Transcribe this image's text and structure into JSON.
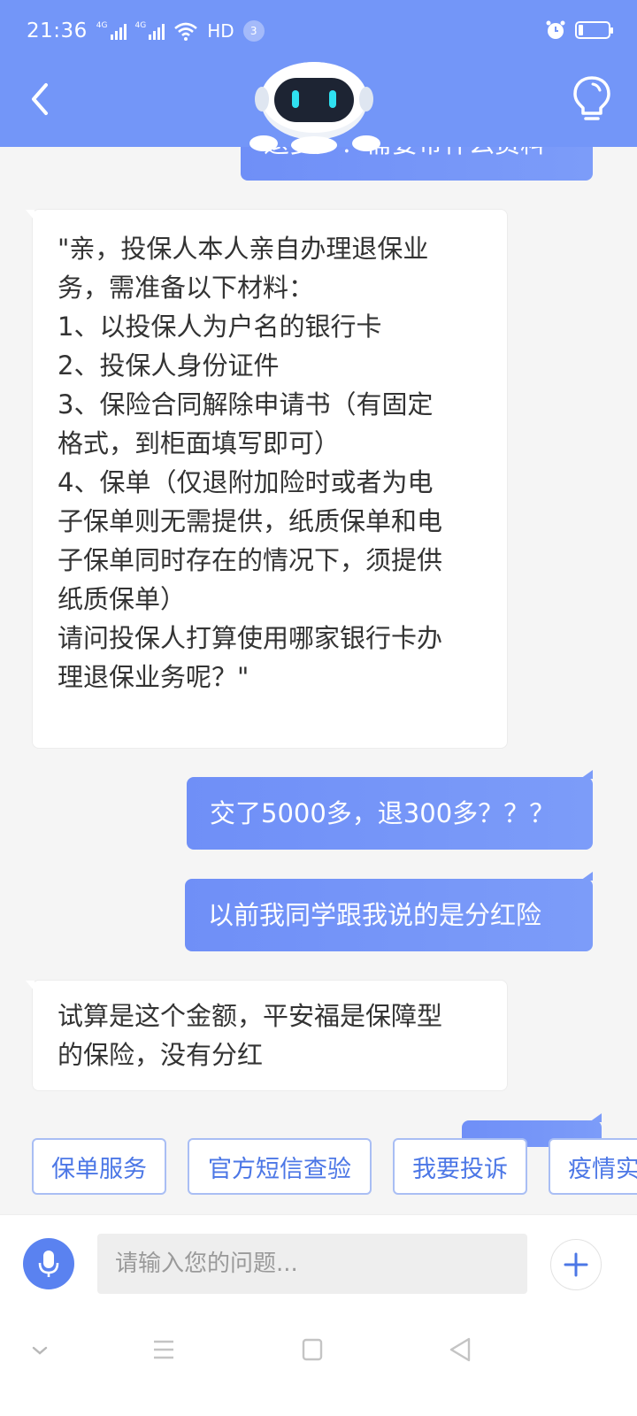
{
  "status_bar": {
    "time": "21:36",
    "signal1_tag": "4G",
    "signal2_tag": "4G",
    "hd_label": "HD",
    "notification_count": "3"
  },
  "header": {
    "accent_color": "#7396f8",
    "back_icon": "chevron-left-icon",
    "bulb_icon": "lightbulb-icon",
    "mascot": "robot-avatar"
  },
  "chat": {
    "partial_user_message": "退多少？需要带什么资料",
    "messages": [
      {
        "sender": "bot",
        "text": "\"亲，投保人本人亲自办理退保业\n务，需准备以下材料：\n1、以投保人为户名的银行卡\n2、投保人身份证件\n3、保险合同解除申请书（有固定\n格式，到柜面填写即可）\n4、保单（仅退附加险时或者为电\n子保单则无需提供，纸质保单和电\n子保单同时存在的情况下，须提供\n纸质保单）\n请问投保人打算使用哪家银行卡办\n理退保业务呢？\""
      },
      {
        "sender": "user",
        "text": "交了5000多，退300多？？？"
      },
      {
        "sender": "user",
        "text": "以前我同学跟我说的是分红险"
      },
      {
        "sender": "bot",
        "text": "试算是这个金额，平安福是保障型\n的保险，没有分红"
      }
    ]
  },
  "quick_replies": [
    "保单服务",
    "官方短信查验",
    "我要投诉",
    "疫情实"
  ],
  "input": {
    "placeholder": "请输入您的问题...",
    "mic_icon": "microphone-icon",
    "plus_icon": "plus-icon"
  },
  "system_nav": [
    "chevron-down-icon",
    "menu-icon",
    "home-square-icon",
    "back-triangle-icon"
  ]
}
